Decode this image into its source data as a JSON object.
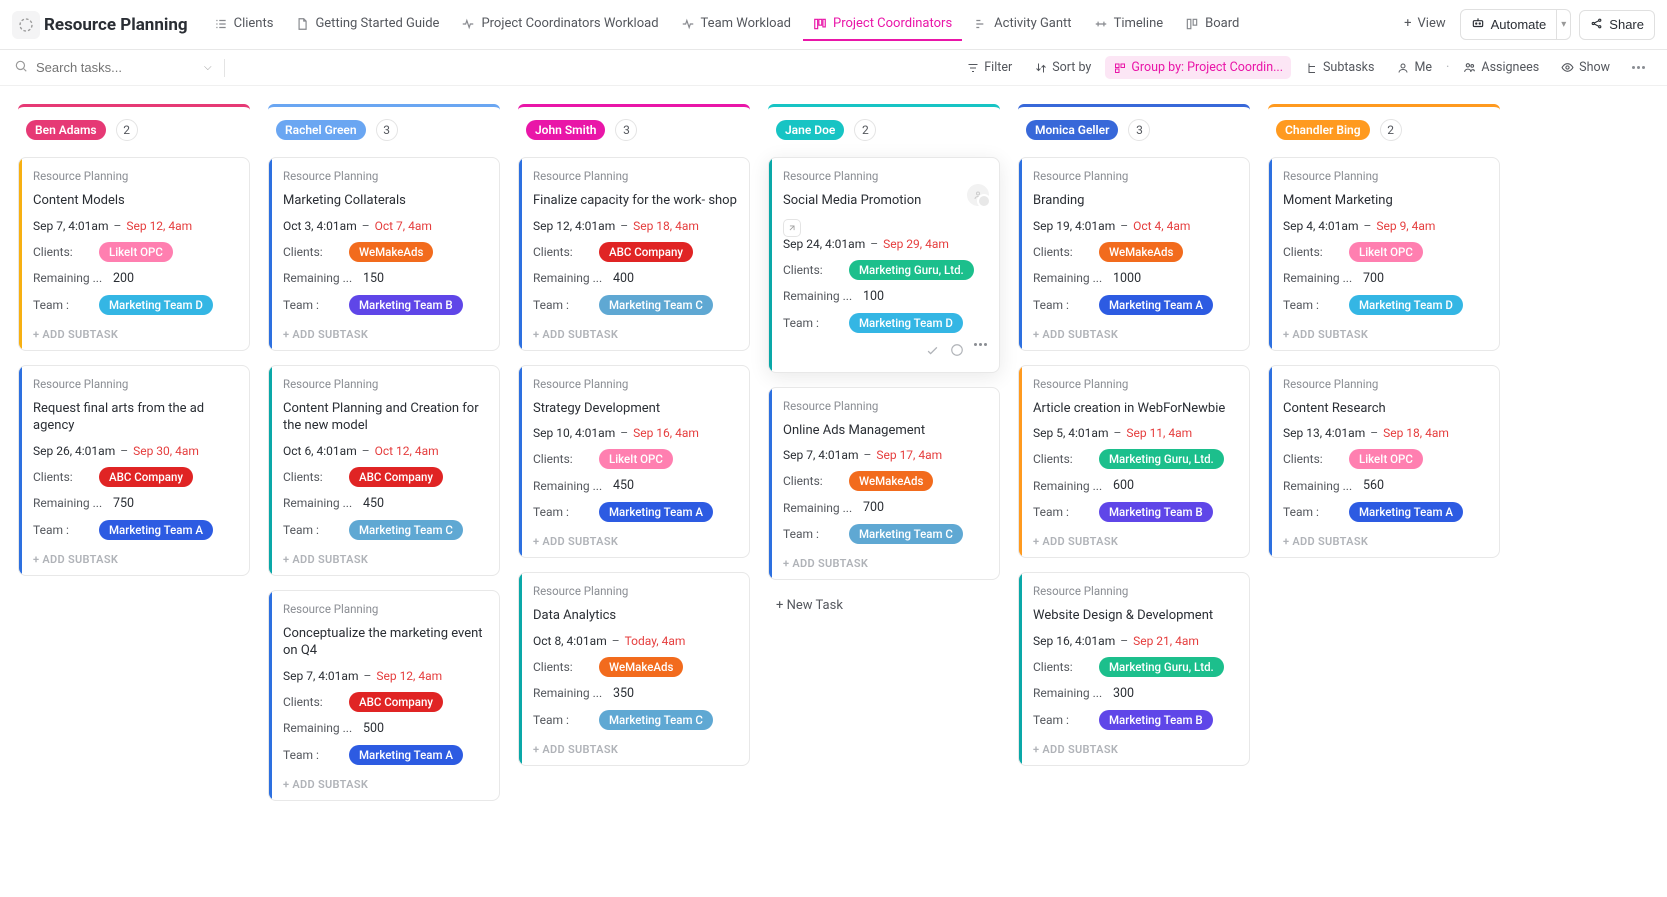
{
  "pageTitle": "Resource Planning",
  "tabs": [
    {
      "label": "Clients",
      "active": false
    },
    {
      "label": "Getting Started Guide",
      "active": false
    },
    {
      "label": "Project Coordinators Workload",
      "active": false
    },
    {
      "label": "Team Workload",
      "active": false
    },
    {
      "label": "Project Coordinators",
      "active": true
    },
    {
      "label": "Activity Gantt",
      "active": false
    },
    {
      "label": "Timeline",
      "active": false
    },
    {
      "label": "Board",
      "active": false
    }
  ],
  "viewBtn": "View",
  "automateBtn": "Automate",
  "shareBtn": "Share",
  "searchPlaceholder": "Search tasks...",
  "toolbar": {
    "filter": "Filter",
    "sort": "Sort by",
    "group": "Group by: Project Coordin...",
    "subtasks": "Subtasks",
    "me": "Me",
    "assignees": "Assignees",
    "show": "Show"
  },
  "breadcrumb": "Resource Planning",
  "addSubtask": "+ ADD SUBTASK",
  "newTask": "+ New Task",
  "fieldLabels": {
    "clients": "Clients:",
    "remaining": "Remaining ...",
    "team": "Team :"
  },
  "colors": {
    "benAdams": "#e63975",
    "rachelGreen": "#6aa6f2",
    "johnSmith": "#e916a8",
    "janeDoe": "#17c4c4",
    "monicaGeller": "#3868d9",
    "chandlerBing": "#ff9a1f",
    "red": "#e53e3e",
    "accent": {
      "yellow": "#f7b012",
      "blue": "#2d70e0",
      "teal": "#0aa8a8",
      "orange": "#ff9a1f"
    },
    "client": {
      "LikeIt OPC": "#ff7fb0",
      "WeMakeAds": "#f26b1d",
      "ABC Company": "#e02424",
      "Marketing Guru, Ltd.": "#1cbf8c"
    },
    "team": {
      "Marketing Team A": "#2d5be2",
      "Marketing Team B": "#5f46e8",
      "Marketing Team C": "#5fa8d3",
      "Marketing Team D": "#34b6e4"
    }
  },
  "columns": [
    {
      "name": "Ben Adams",
      "count": "2",
      "headerColor": "benAdams",
      "cards": [
        {
          "title": "Content Models",
          "start": "Sep 7, 4:01am",
          "end": "Sep 12, 4am",
          "client": "LikeIt OPC",
          "remaining": "200",
          "team": "Marketing Team D",
          "accent": "yellow"
        },
        {
          "title": "Request final arts from the ad agency",
          "start": "Sep 26, 4:01am",
          "end": "Sep 30, 4am",
          "client": "ABC Company",
          "remaining": "750",
          "team": "Marketing Team A",
          "accent": "blue"
        }
      ]
    },
    {
      "name": "Rachel Green",
      "count": "3",
      "headerColor": "rachelGreen",
      "cards": [
        {
          "title": "Marketing Collaterals",
          "start": "Oct 3, 4:01am",
          "end": "Oct 7, 4am",
          "client": "WeMakeAds",
          "remaining": "150",
          "team": "Marketing Team B",
          "accent": "blue"
        },
        {
          "title": "Content Planning and Creation for the new model",
          "start": "Oct 6, 4:01am",
          "end": "Oct 12, 4am",
          "client": "ABC Company",
          "remaining": "450",
          "team": "Marketing Team C",
          "accent": "teal"
        },
        {
          "title": "Conceptualize the marketing event on Q4",
          "start": "Sep 7, 4:01am",
          "end": "Sep 12, 4am",
          "client": "ABC Company",
          "remaining": "500",
          "team": "Marketing Team A",
          "accent": "blue"
        }
      ]
    },
    {
      "name": "John Smith",
      "count": "3",
      "headerColor": "johnSmith",
      "cards": [
        {
          "title": "Finalize capacity for the work- shop",
          "start": "Sep 12, 4:01am",
          "end": "Sep 18, 4am",
          "client": "ABC Company",
          "remaining": "400",
          "team": "Marketing Team C",
          "accent": "blue"
        },
        {
          "title": "Strategy Development",
          "start": "Sep 10, 4:01am",
          "end": "Sep 16, 4am",
          "client": "LikeIt OPC",
          "remaining": "450",
          "team": "Marketing Team A",
          "accent": "blue"
        },
        {
          "title": "Data Analytics",
          "start": "Oct 8, 4:01am",
          "end": "Today, 4am",
          "client": "WeMakeAds",
          "remaining": "350",
          "team": "Marketing Team C",
          "accent": "teal"
        }
      ]
    },
    {
      "name": "Jane Doe",
      "count": "2",
      "headerColor": "janeDoe",
      "cards": [
        {
          "title": "Social Media Promotion",
          "start": "Sep 24, 4:01am",
          "end": "Sep 29, 4am",
          "client": "Marketing Guru, Ltd.",
          "remaining": "100",
          "team": "Marketing Team D",
          "accent": "teal",
          "hovered": true,
          "showLink": true,
          "showAvatar": true,
          "showFooter": true
        },
        {
          "title": "Online Ads Management",
          "start": "Sep 7, 4:01am",
          "end": "Sep 17, 4am",
          "client": "WeMakeAds",
          "remaining": "700",
          "team": "Marketing Team C",
          "accent": "blue"
        }
      ],
      "showNewTask": true
    },
    {
      "name": "Monica Geller",
      "count": "3",
      "headerColor": "monicaGeller",
      "cards": [
        {
          "title": "Branding",
          "start": "Sep 19, 4:01am",
          "end": "Oct 4, 4am",
          "client": "WeMakeAds",
          "remaining": "1000",
          "team": "Marketing Team A",
          "accent": "blue"
        },
        {
          "title": "Article creation in WebForNewbie",
          "start": "Sep 5, 4:01am",
          "end": "Sep 11, 4am",
          "client": "Marketing Guru, Ltd.",
          "remaining": "600",
          "team": "Marketing Team B",
          "accent": "orange"
        },
        {
          "title": "Website Design & Development",
          "start": "Sep 16, 4:01am",
          "end": "Sep 21, 4am",
          "client": "Marketing Guru, Ltd.",
          "remaining": "300",
          "team": "Marketing Team B",
          "accent": "teal"
        }
      ]
    },
    {
      "name": "Chandler Bing",
      "count": "2",
      "headerColor": "chandlerBing",
      "cards": [
        {
          "title": "Moment Marketing",
          "start": "Sep 4, 4:01am",
          "end": "Sep 9, 4am",
          "client": "LikeIt OPC",
          "remaining": "700",
          "team": "Marketing Team D",
          "accent": "blue"
        },
        {
          "title": "Content Research",
          "start": "Sep 13, 4:01am",
          "end": "Sep 18, 4am",
          "client": "LikeIt OPC",
          "remaining": "560",
          "team": "Marketing Team A",
          "accent": "blue"
        }
      ]
    }
  ]
}
